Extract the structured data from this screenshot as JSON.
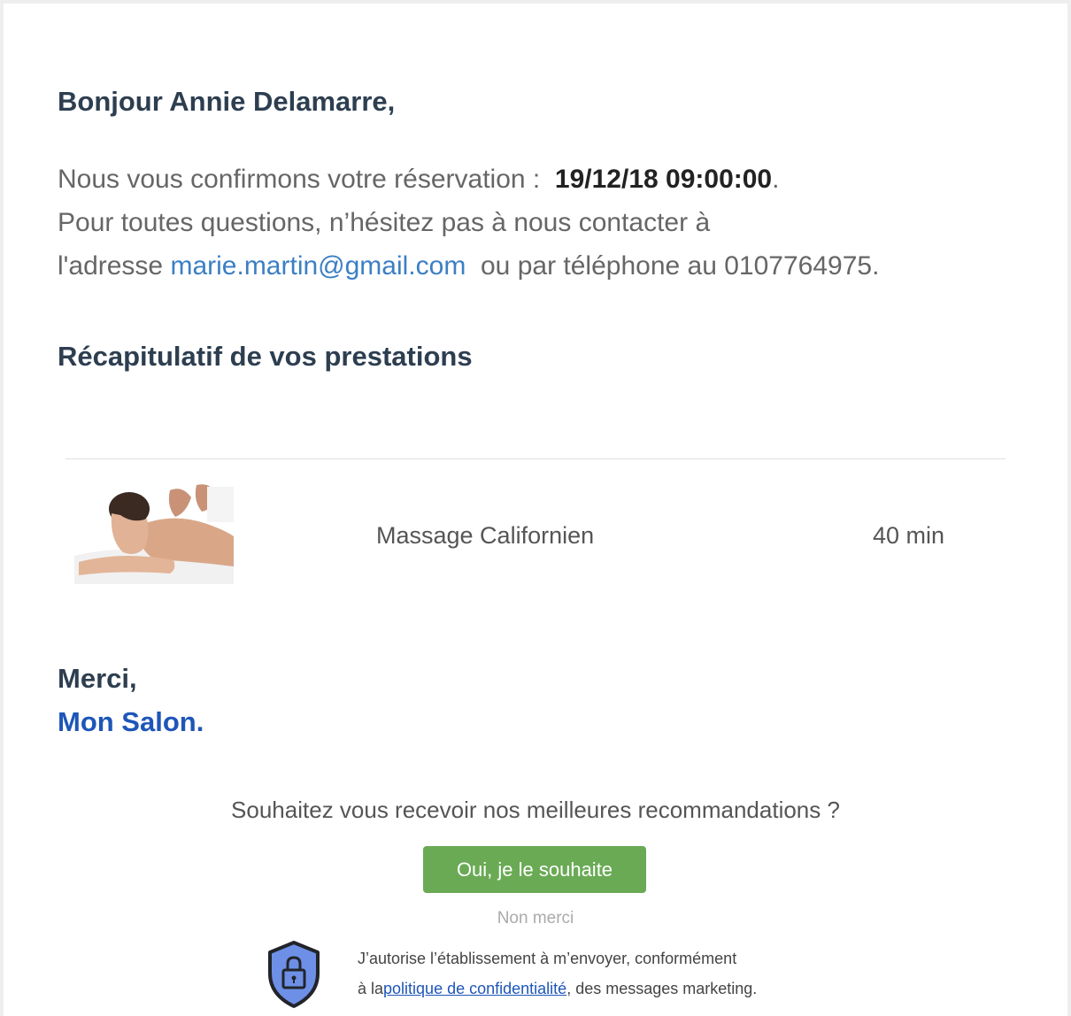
{
  "email": {
    "greeting": "Bonjour Annie Delamarre,",
    "confirm_prefix": "Nous vous confirmons votre réservation :",
    "reservation_datetime": "19/12/18 09:00:00",
    "confirm_suffix": ".",
    "contact_line": "Pour toutes questions, n’hésitez pas à nous contacter  à",
    "address_prefix": "l'adresse",
    "email_address": "marie.martin@gmail.com",
    "or_text": "ou  par téléphone au",
    "phone": "0107764975",
    "phone_suffix": ".",
    "recap_title": "Récapitulatif de vos prestations",
    "services": [
      {
        "name": "Massage Californien",
        "duration": "40 min",
        "image": "massage-photo"
      }
    ],
    "thanks": "Merci,",
    "salon_name": "Mon Salon."
  },
  "marketing": {
    "question": "Souhaitez vous recevoir nos meilleures recommandations ?",
    "yes_label": "Oui, je le souhaite",
    "no_label": "Non merci",
    "consent_line1": "J’autorise l’établissement à m’envoyer, conformément",
    "consent_prefix": "à la",
    "privacy_link": "politique de confidentialité",
    "consent_suffix": ", des messages marketing.",
    "icon": "shield-lock-icon"
  },
  "colors": {
    "heading": "#2d3e50",
    "body_text": "#666666",
    "link": "#3b7fc4",
    "salon": "#1e56b8",
    "button": "#6aaa55",
    "shield_fill": "#6d8fe6"
  }
}
